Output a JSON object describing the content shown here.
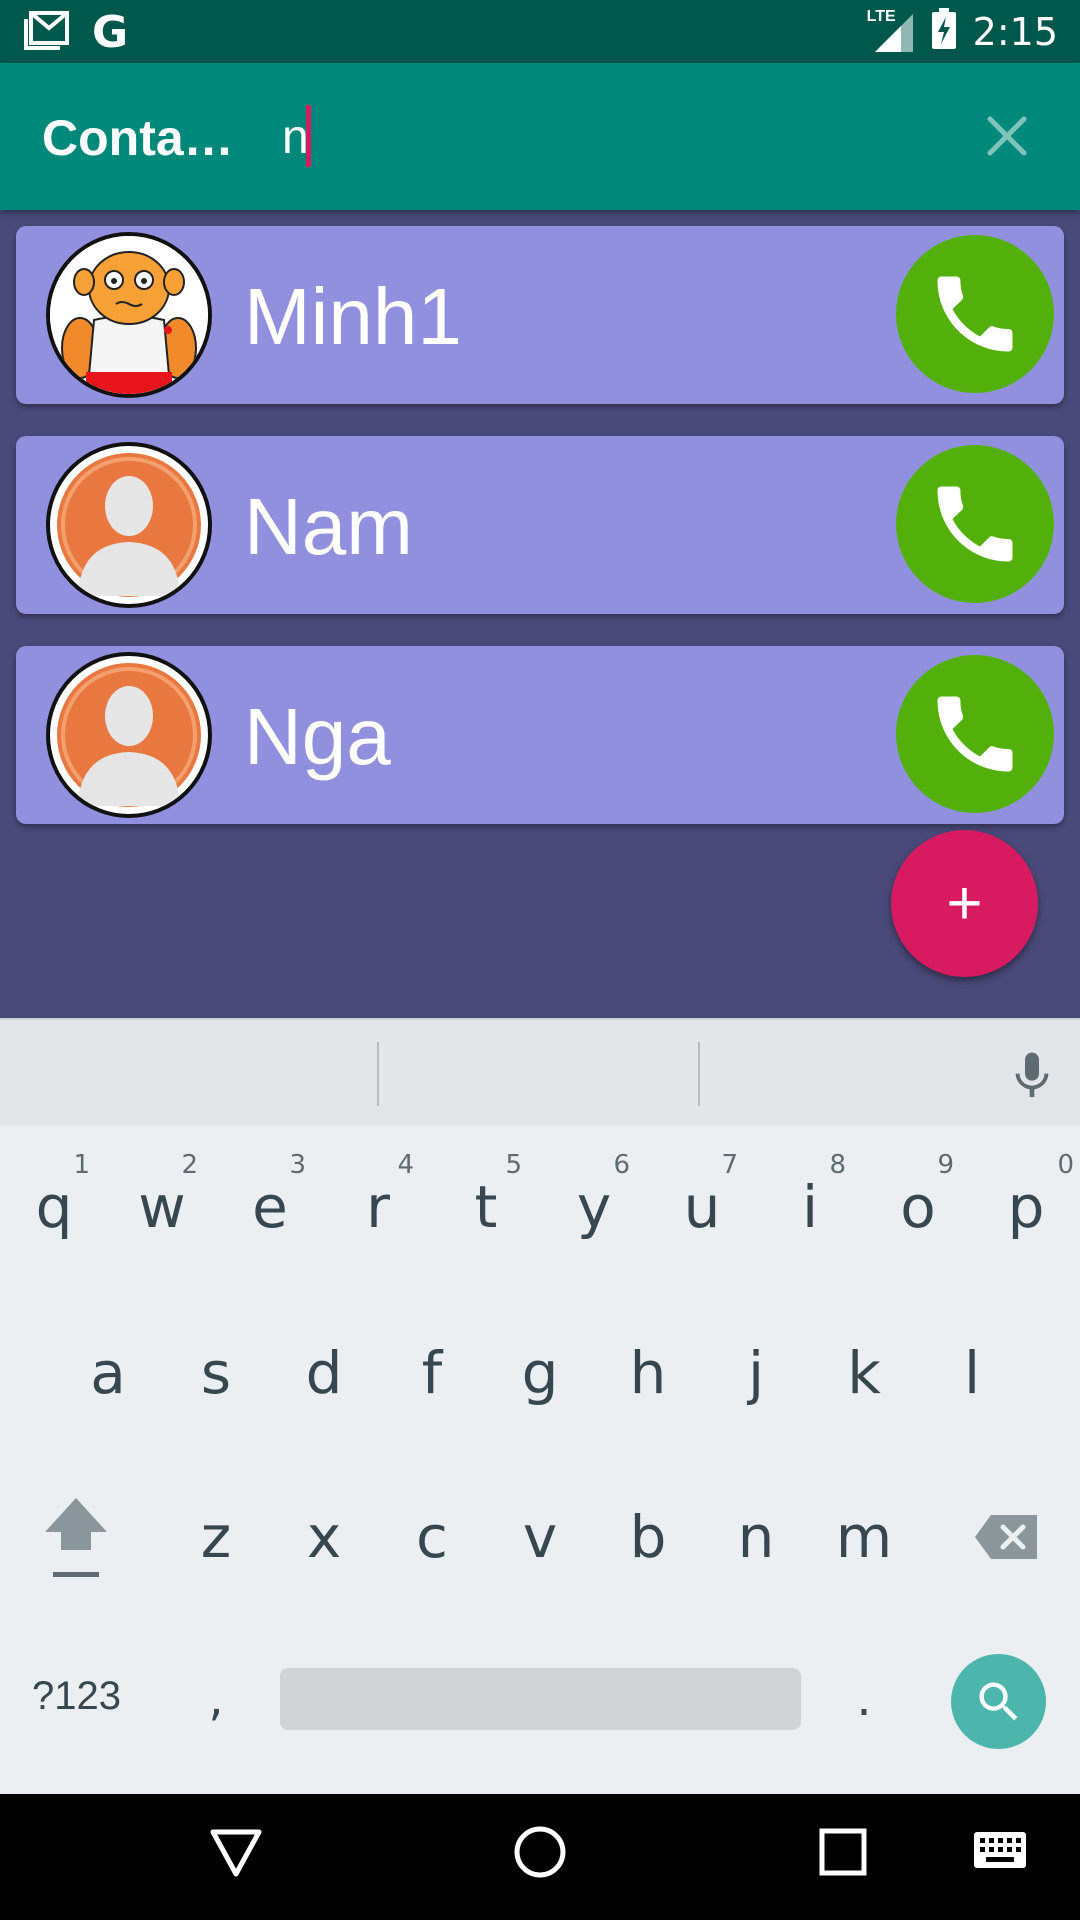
{
  "status_bar": {
    "time": "2:15",
    "network_label": "LTE",
    "icons": [
      "gmail-icon",
      "google-icon",
      "lte-signal-icon",
      "battery-charging-icon"
    ]
  },
  "app_bar": {
    "title": "Conta…",
    "search_value": "n",
    "clear_icon": "close-icon"
  },
  "contacts": [
    {
      "name": "Minh1",
      "avatar": "cartoon-avatar",
      "call_icon": "phone-icon"
    },
    {
      "name": "Nam",
      "avatar": "default-person-avatar",
      "call_icon": "phone-icon"
    },
    {
      "name": "Nga",
      "avatar": "default-person-avatar",
      "call_icon": "phone-icon"
    }
  ],
  "fab": {
    "label": "+"
  },
  "keyboard": {
    "row1": [
      {
        "key": "q",
        "hint": "1"
      },
      {
        "key": "w",
        "hint": "2"
      },
      {
        "key": "e",
        "hint": "3"
      },
      {
        "key": "r",
        "hint": "4"
      },
      {
        "key": "t",
        "hint": "5"
      },
      {
        "key": "y",
        "hint": "6"
      },
      {
        "key": "u",
        "hint": "7"
      },
      {
        "key": "i",
        "hint": "8"
      },
      {
        "key": "o",
        "hint": "9"
      },
      {
        "key": "p",
        "hint": "0"
      }
    ],
    "row2": [
      "a",
      "s",
      "d",
      "f",
      "g",
      "h",
      "j",
      "k",
      "l"
    ],
    "row3": [
      "z",
      "x",
      "c",
      "v",
      "b",
      "n",
      "m"
    ],
    "symbols_label": "?123",
    "comma": ",",
    "period": ".",
    "colors": {
      "background": "#eceff1",
      "key_text": "#37474f",
      "action": "#4db6ac"
    }
  },
  "colors": {
    "status_bar": "#00574b",
    "app_bar": "#00897b",
    "list_background": "#4a4a7a",
    "card": "#9190de",
    "call_button": "#53b00a",
    "fab": "#d81b60"
  }
}
